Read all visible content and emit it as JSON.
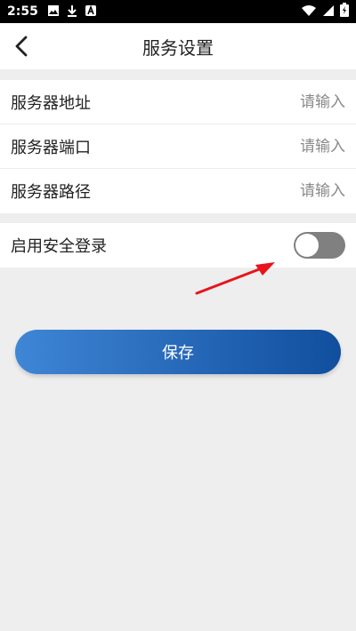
{
  "status_bar": {
    "time": "2:55",
    "icons_left": [
      "image-icon",
      "download-icon",
      "app-a-icon"
    ],
    "icons_right": [
      "wifi-icon",
      "signal-icon",
      "battery-charging-icon"
    ]
  },
  "header": {
    "title": "服务设置",
    "back_icon": "chevron-left-icon"
  },
  "form": {
    "fields": [
      {
        "label": "服务器地址",
        "placeholder": "请输入",
        "value": ""
      },
      {
        "label": "服务器端口",
        "placeholder": "请输入",
        "value": ""
      },
      {
        "label": "服务器路径",
        "placeholder": "请输入",
        "value": ""
      }
    ],
    "secure_login": {
      "label": "启用安全登录",
      "enabled": false
    }
  },
  "save_button": {
    "label": "保存"
  },
  "colors": {
    "button_start": "#3f86d6",
    "button_end": "#114e9e",
    "toggle_off": "#808080",
    "annotation_arrow": "#e8141c"
  }
}
